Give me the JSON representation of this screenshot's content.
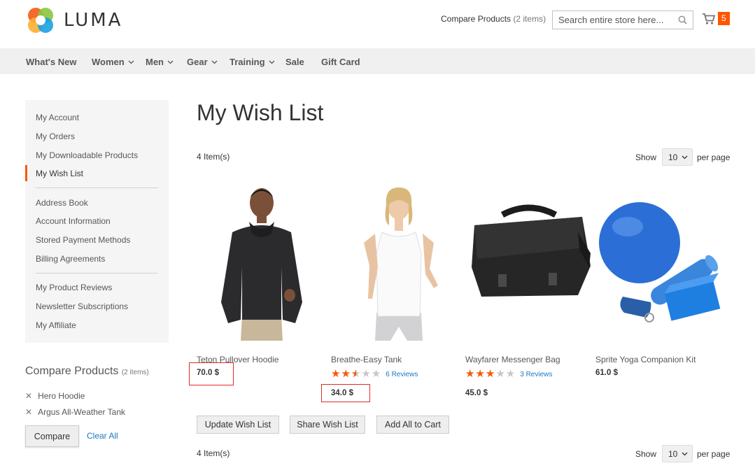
{
  "header": {
    "logo_text": "LUMA",
    "compare_label": "Compare Products",
    "compare_count": "(2 items)",
    "search_placeholder": "Search entire store here...",
    "cart_count": "5"
  },
  "nav": {
    "items": [
      {
        "label": "What's New",
        "dropdown": false
      },
      {
        "label": "Women",
        "dropdown": true
      },
      {
        "label": "Men",
        "dropdown": true
      },
      {
        "label": "Gear",
        "dropdown": true
      },
      {
        "label": "Training",
        "dropdown": true
      },
      {
        "label": "Sale",
        "dropdown": false
      },
      {
        "label": "Gift Card",
        "dropdown": false
      }
    ]
  },
  "sidebar": {
    "items": [
      {
        "label": "My Account"
      },
      {
        "label": "My Orders"
      },
      {
        "label": "My Downloadable Products"
      },
      {
        "label": "My Wish List",
        "active": true
      },
      {
        "label": "Address Book"
      },
      {
        "label": "Account Information"
      },
      {
        "label": "Stored Payment Methods"
      },
      {
        "label": "Billing Agreements"
      },
      {
        "label": "My Product Reviews"
      },
      {
        "label": "Newsletter Subscriptions"
      },
      {
        "label": "My Affiliate"
      }
    ]
  },
  "compare": {
    "title": "Compare Products",
    "count": "(2 items)",
    "items": [
      "Hero Hoodie",
      "Argus All-Weather Tank"
    ],
    "compare_button": "Compare",
    "clear_all": "Clear All"
  },
  "main": {
    "title": "My Wish List",
    "item_count": "4 Item(s)",
    "show_label": "Show",
    "per_page_value": "10",
    "per_page_label": "per page",
    "products": [
      {
        "name": "Teton Pullover Hoodie",
        "price": "70.0 $",
        "rating": null,
        "reviews": null,
        "highlighted": true
      },
      {
        "name": "Breathe-Easy Tank",
        "price": "34.0 $",
        "rating": 0.5,
        "reviews": "6  Reviews",
        "highlighted": true
      },
      {
        "name": "Wayfarer Messenger Bag",
        "price": "45.0 $",
        "rating": 0.6,
        "reviews": "3  Reviews",
        "highlighted": false
      },
      {
        "name": "Sprite Yoga Companion Kit",
        "price": "61.0 $",
        "rating": null,
        "reviews": null,
        "highlighted": false
      }
    ],
    "buttons": {
      "update": "Update Wish List",
      "share": "Share Wish List",
      "add_all": "Add All to Cart"
    }
  },
  "colors": {
    "accent": "#ff5501",
    "link": "#1979c3",
    "highlight_box": "#e02b27"
  }
}
